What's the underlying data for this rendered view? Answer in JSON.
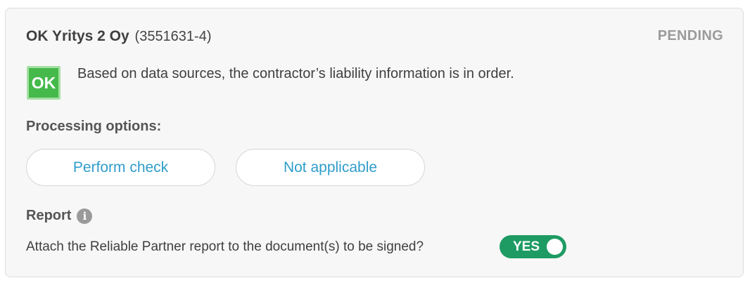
{
  "company": {
    "name": "OK Yritys 2 Oy",
    "id": "(3551631-4)",
    "status": "PENDING"
  },
  "liability": {
    "badge": "OK",
    "badge_color": "#46b94b",
    "message": "Based on data sources, the contractor’s liability information is in order."
  },
  "processing": {
    "label": "Processing options:",
    "options": [
      {
        "label": "Perform check"
      },
      {
        "label": "Not applicable"
      }
    ],
    "option_text_color": "#2f9dcb"
  },
  "report": {
    "label": "Report",
    "info_icon": "info-icon",
    "question": "Attach the Reliable Partner report to the document(s) to be signed?",
    "toggle": {
      "label": "YES",
      "on": true,
      "color": "#1e9b63"
    }
  }
}
